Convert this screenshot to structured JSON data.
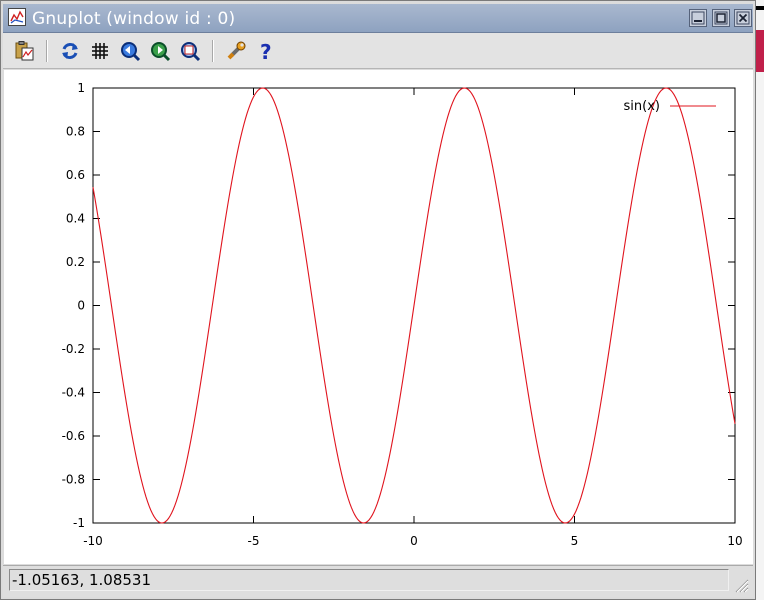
{
  "window": {
    "title": "Gnuplot (window id : 0)"
  },
  "toolbar": {
    "items": [
      {
        "name": "copy-to-clipboard-icon"
      },
      {
        "name": "replot-icon"
      },
      {
        "name": "grid-icon"
      },
      {
        "name": "zoom-previous-icon"
      },
      {
        "name": "zoom-next-icon"
      },
      {
        "name": "autoscale-icon"
      },
      {
        "name": "configure-icon"
      },
      {
        "name": "help-icon"
      }
    ]
  },
  "status": {
    "coordinates": "-1.05163,  1.08531"
  },
  "colors": {
    "curve": "#e0141e",
    "titlebar": "#9aabc6"
  },
  "chart_data": {
    "type": "line",
    "function": "sin(x)",
    "series": [
      {
        "name": "sin(x)",
        "color": "#e0141e",
        "x_range": [
          -10,
          10
        ]
      }
    ],
    "xlim": [
      -10,
      10
    ],
    "ylim": [
      -1,
      1
    ],
    "xticks": [
      "-10",
      "-5",
      "0",
      "5",
      "10"
    ],
    "yticks": [
      "1",
      "0.8",
      "0.6",
      "0.4",
      "0.2",
      "0",
      "-0.2",
      "-0.4",
      "-0.6",
      "-0.8",
      "-1"
    ],
    "legend_position": "top-right",
    "legend_label": "sin(x)",
    "grid": false
  }
}
